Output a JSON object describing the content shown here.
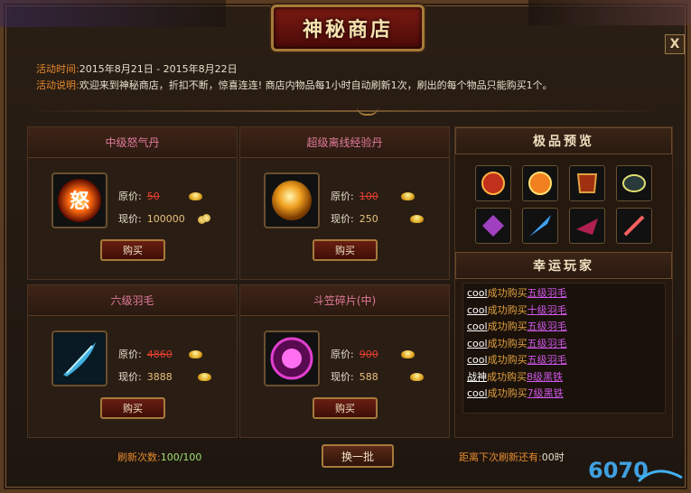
{
  "window": {
    "title": "神秘商店",
    "close_label": "X"
  },
  "info": {
    "time_key": "活动时间:",
    "time_value": "2015年8月21日 - 2015年8月22日",
    "desc_key": "活动说明:",
    "desc_value": "欢迎来到神秘商店，折扣不断，惊喜连连! 商店内物品每1小时自动刷新1次，刷出的每个物品只能购买1个。"
  },
  "shop": {
    "items": [
      {
        "name": "中级怒气丹",
        "orig_label": "原价:",
        "orig_price": "50",
        "now_label": "现价:",
        "now_price": "100000",
        "currency": "gold-coin",
        "icon": "fire-orb-icon",
        "buy_label": "购买"
      },
      {
        "name": "超级离线经验丹",
        "orig_label": "原价:",
        "orig_price": "100",
        "now_label": "现价:",
        "now_price": "250",
        "currency": "bound-ingot",
        "icon": "golden-orb-icon",
        "buy_label": "购买"
      },
      {
        "name": "六级羽毛",
        "orig_label": "原价:",
        "orig_price": "4860",
        "now_label": "现价:",
        "now_price": "3888",
        "currency": "ingot",
        "icon": "blue-feather-icon",
        "buy_label": "购买"
      },
      {
        "name": "斗笠碎片(中)",
        "orig_label": "原价:",
        "orig_price": "900",
        "now_label": "现价:",
        "now_price": "588",
        "currency": "ingot",
        "icon": "pink-amulet-icon",
        "buy_label": "购买"
      }
    ]
  },
  "preview": {
    "title": "极品预览",
    "items": [
      "red-gem-icon",
      "fire-ring-icon",
      "armor-icon",
      "bracer-icon",
      "purple-crystal-icon",
      "blue-blade-icon",
      "red-wing-icon",
      "sword-icon"
    ]
  },
  "lucky": {
    "title": "幸运玩家",
    "entries": [
      {
        "user": "cool",
        "text": "成功购买",
        "item": "五级羽毛"
      },
      {
        "user": "cool",
        "text": "成功购买",
        "item": "十级羽毛"
      },
      {
        "user": "cool",
        "text": "成功购买",
        "item": "五级羽毛"
      },
      {
        "user": "cool",
        "text": "成功购买",
        "item": "五级羽毛"
      },
      {
        "user": "cool",
        "text": "成功购买",
        "item": "五级羽毛"
      },
      {
        "user": "战神",
        "text": "成功购买",
        "item": "8级黑铁"
      },
      {
        "user": "cool",
        "text": "成功购买",
        "item": "7级黑铁"
      }
    ]
  },
  "footer": {
    "refresh_label": "刷新次数:",
    "refresh_value": "100/100",
    "swap_label": "换一批",
    "next_label": "距离下次刷新还有:",
    "next_value": "00时"
  },
  "logo": {
    "text": "6070"
  }
}
